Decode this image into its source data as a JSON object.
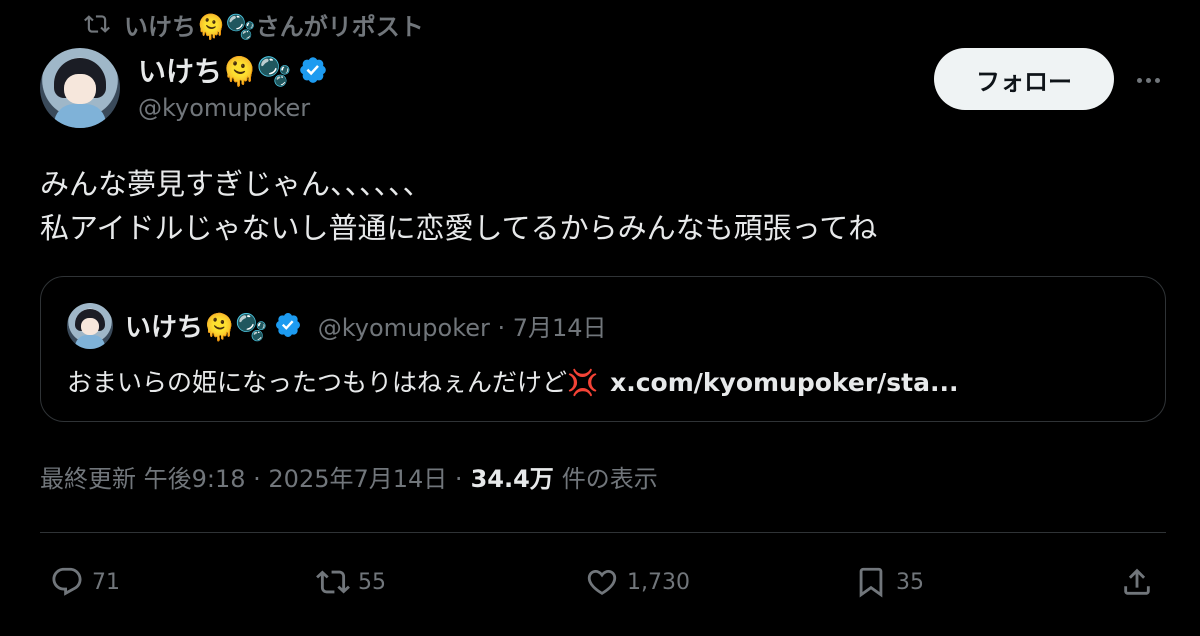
{
  "repost": {
    "text": "いけち🫠🫧さんがリポスト",
    "icon": "repost-icon"
  },
  "author": {
    "name": "いけち🫠🫧",
    "handle": "@kyomupoker",
    "verified": true,
    "badge_color": "#1d9bf0"
  },
  "follow_button": {
    "label": "フォロー"
  },
  "tweet": {
    "lines": [
      "みんな夢見すぎじゃん、、、、、、",
      "私アイドルじゃないし普通に恋愛してるからみんなも頑張ってね"
    ]
  },
  "quote": {
    "name": "いけち🫠🫧",
    "meta": "@kyomupoker · 7月14日",
    "text": "おまいらの姫になったつもりはねぇんだけど💢",
    "link": "x.com/kyomupoker/sta..."
  },
  "meta": {
    "updated": "最終更新 午後9:18 · 2025年7月14日 ·",
    "views_count": "34.4万",
    "views_label": "件の表示"
  },
  "actions": {
    "reply": "71",
    "repost": "55",
    "like": "1,730",
    "bookmark": "35"
  },
  "colors": {
    "background": "#000000",
    "text": "#e7e9ea",
    "secondary": "#71767b",
    "border": "#2f3336",
    "accent": "#1d9bf0"
  }
}
